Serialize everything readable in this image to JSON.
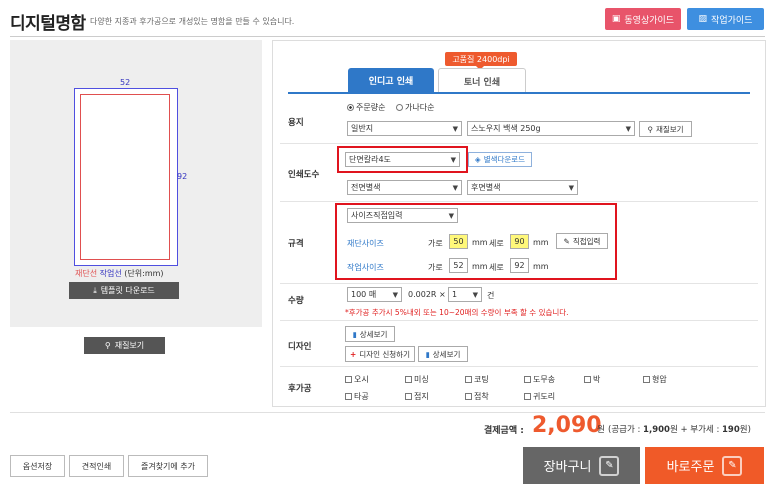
{
  "header": {
    "title": "디지털명함",
    "subtitle": "다양한 지종과 후가공으로 개성있는 명함을 만들 수 있습니다.",
    "video_guide": "동영상가이드",
    "work_guide": "작업가이드"
  },
  "preview": {
    "width_label": "52",
    "height_label": "92",
    "legend_cut": "재단선",
    "legend_work": "작업선",
    "legend_unit": "(단위:mm)",
    "template_download": "템플릿 다운로드",
    "paper_view": "재질보기"
  },
  "tabs": {
    "indigo": "인디고 인쇄",
    "toner": "토너 인쇄",
    "badge": "고품질 2400dpi"
  },
  "paper": {
    "label": "용지",
    "radio_order": "주문량순",
    "radio_alpha": "가나다순",
    "type": "일반지",
    "stock": "스노우지 백색 250g",
    "view_btn": "재질보기"
  },
  "print": {
    "label": "인쇄도수",
    "color": "단면칼라4도",
    "download_btn": "별색다운로드",
    "front": "전면별색",
    "back": "후면별색"
  },
  "spec": {
    "label": "규격",
    "mode": "사이즈직접입력",
    "cut_label": "재단사이즈",
    "work_label": "작업사이즈",
    "w_label": "가로",
    "h_label": "세로",
    "unit": "mm",
    "cut_w": "50",
    "cut_h": "90",
    "work_w": "52",
    "work_h": "92",
    "direct_btn": "직접입력"
  },
  "quantity": {
    "label": "수량",
    "qty": "100 매",
    "mult": "0.002R ×",
    "count": "1",
    "unit": "건",
    "warning": "*후가공 추가시 5%내외 또는 10~20매의 수량이 부족 할 수 있습니다."
  },
  "design": {
    "label": "디자인",
    "detail1": "상세보기",
    "apply": "디자인 신청하기",
    "detail2": "상세보기"
  },
  "finishing": {
    "label": "후가공",
    "row1": [
      "오시",
      "미싱",
      "코팅",
      "도무송",
      "박",
      "형압"
    ],
    "row2": [
      "타공",
      "접지",
      "접착",
      "귀도리"
    ]
  },
  "total": {
    "label": "결제금액 :",
    "amount": "2,090",
    "unit": "원",
    "supply_prefix": "(공급가 : ",
    "supply": "1,900",
    "supply_mid": "원 + 부가세 : ",
    "vat": "190",
    "suffix": "원)"
  },
  "actions": {
    "save_option": "옵션저장",
    "estimate": "견적인쇄",
    "favorite": "즐겨찾기에 추가",
    "cart": "장바구니",
    "order": "바로주문"
  }
}
